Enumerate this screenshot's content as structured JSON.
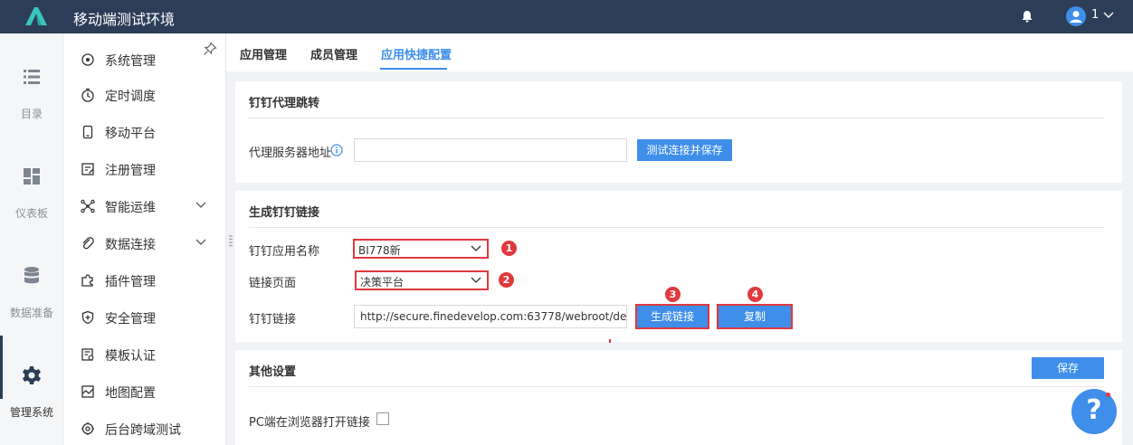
{
  "header": {
    "title": "移动端测试环境",
    "user": "1"
  },
  "rail": [
    {
      "label": "目录",
      "icon": "list-icon"
    },
    {
      "label": "仪表板",
      "icon": "dashboard-icon"
    },
    {
      "label": "数据准备",
      "icon": "database-icon"
    },
    {
      "label": "管理系统",
      "icon": "gear-icon",
      "active": true
    }
  ],
  "sidebar": {
    "items": [
      {
        "label": "系统管理"
      },
      {
        "label": "定时调度"
      },
      {
        "label": "移动平台"
      },
      {
        "label": "注册管理"
      },
      {
        "label": "智能运维"
      },
      {
        "label": "数据连接"
      },
      {
        "label": "插件管理"
      },
      {
        "label": "安全管理"
      },
      {
        "label": "模板认证"
      },
      {
        "label": "地图配置"
      },
      {
        "label": "后台跨域测试"
      }
    ]
  },
  "tabs": [
    {
      "label": "应用管理"
    },
    {
      "label": "成员管理"
    },
    {
      "label": "应用快捷配置",
      "active": true
    }
  ],
  "proxy": {
    "title": "钉钉代理跳转",
    "field_label": "代理服务器地址",
    "field_value": "",
    "test_button": "测试连接并保存"
  },
  "link": {
    "title": "生成钉钉链接",
    "app_label": "钉钉应用名称",
    "app_value": "BI778新",
    "page_label": "链接页面",
    "page_value": "决策平台",
    "link_label": "钉钉链接",
    "link_value": "http://secure.finedevelop.com:63778/webroot/decis ...",
    "generate_button": "生成链接",
    "copy_button": "复制",
    "badges": [
      "1",
      "2",
      "3",
      "4"
    ]
  },
  "other": {
    "title": "其他设置",
    "save_button": "保存",
    "pc_label": "PC端在浏览器打开链接",
    "pc_checked": false
  },
  "help": {
    "label": "?"
  },
  "colors": {
    "primary": "#3e8eea",
    "header": "#2c3e57",
    "highlight": "#e0393e"
  }
}
